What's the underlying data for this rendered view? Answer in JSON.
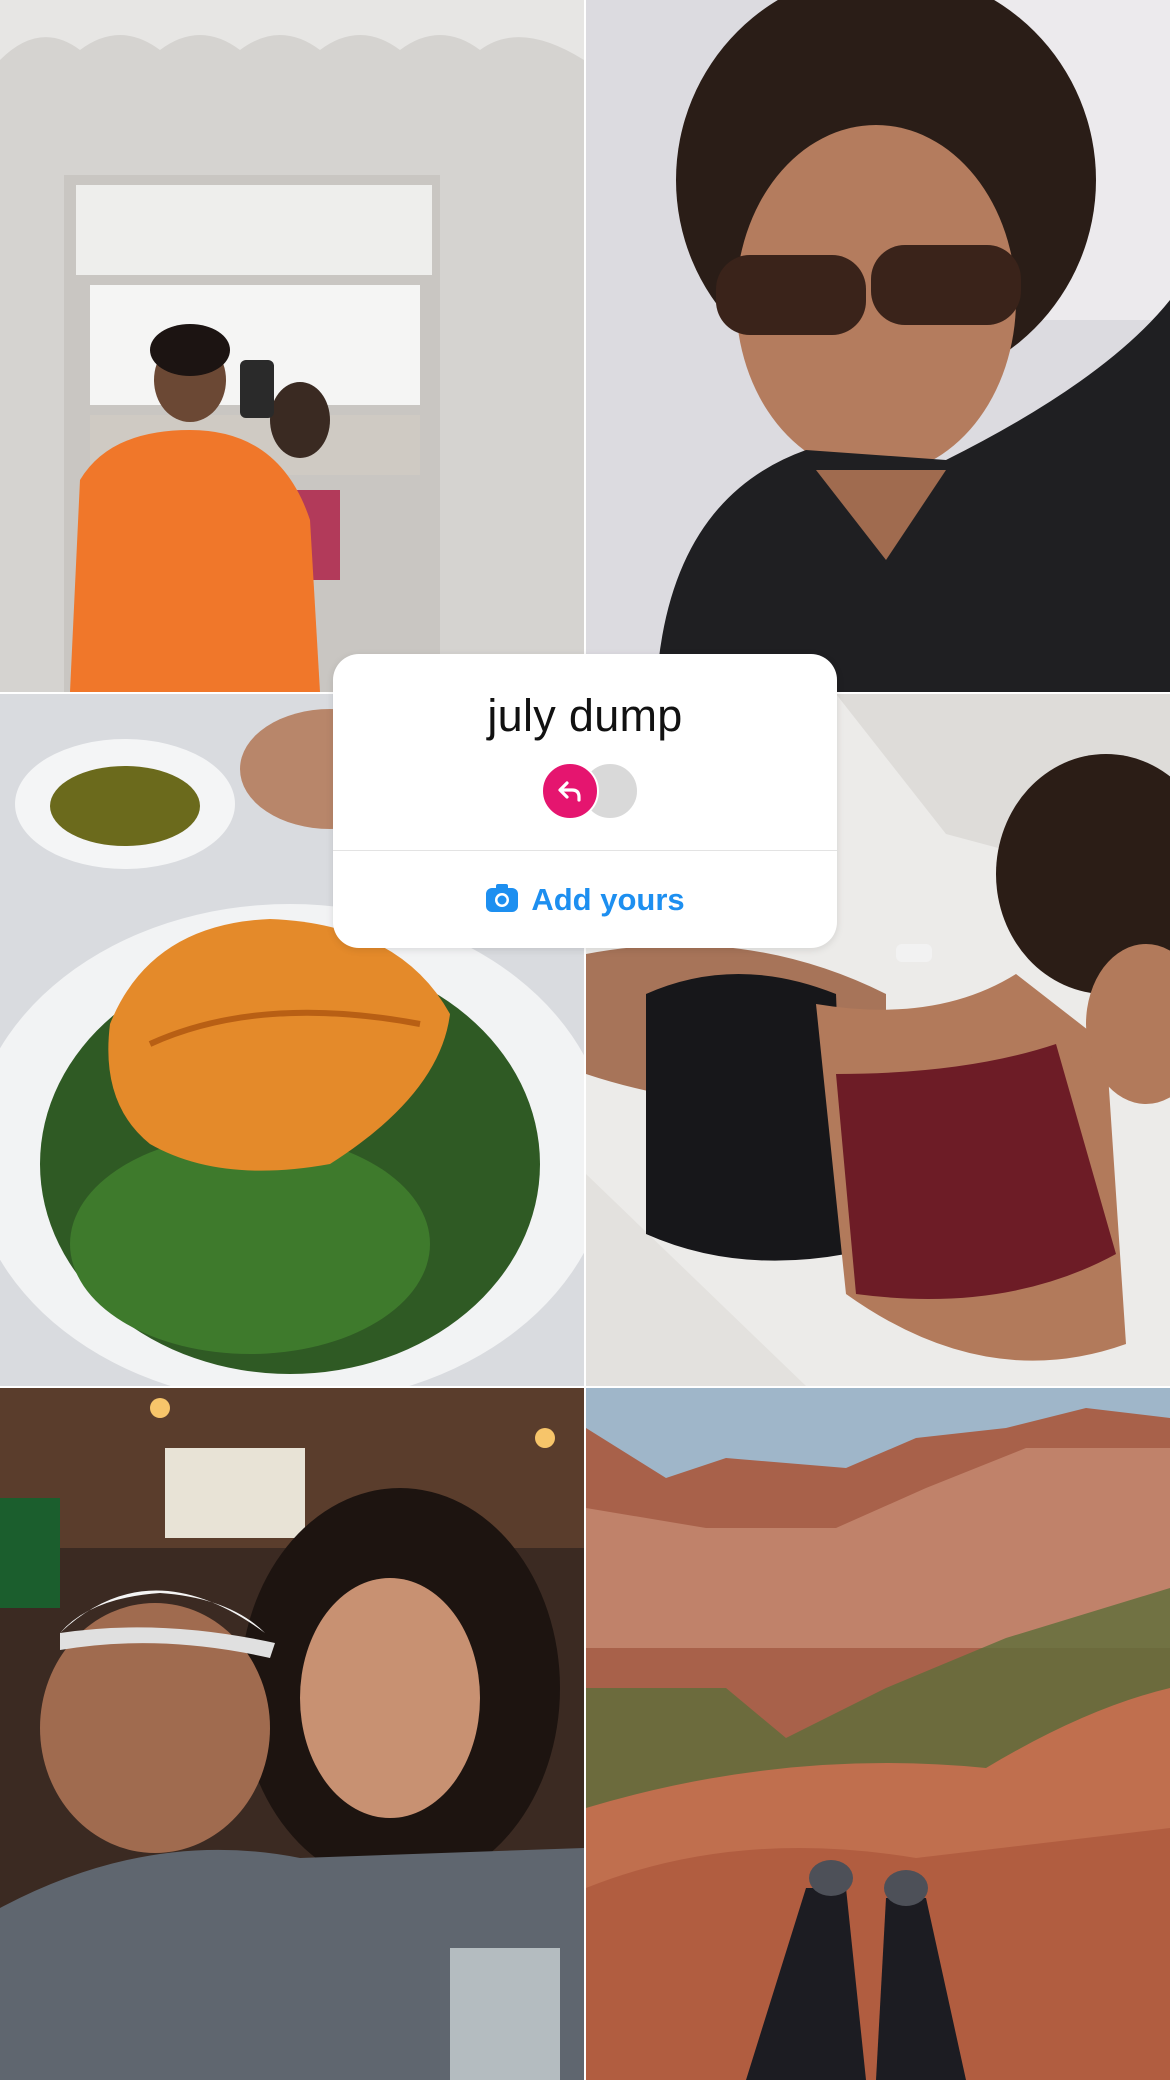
{
  "sticker": {
    "title": "july dump",
    "action_label": "Add yours",
    "accent_color": "#1d8ff0",
    "reply_badge_color": "#e5156f",
    "icons": [
      "reply-arrow-icon",
      "camera-icon"
    ]
  },
  "photos": [
    {
      "name": "mirror-selfie-photo"
    },
    {
      "name": "sunglasses-selfie-photo"
    },
    {
      "name": "salmon-salad-photo"
    },
    {
      "name": "fitness-selfie-photo"
    },
    {
      "name": "father-daughter-photo"
    },
    {
      "name": "canyon-view-photo"
    }
  ]
}
